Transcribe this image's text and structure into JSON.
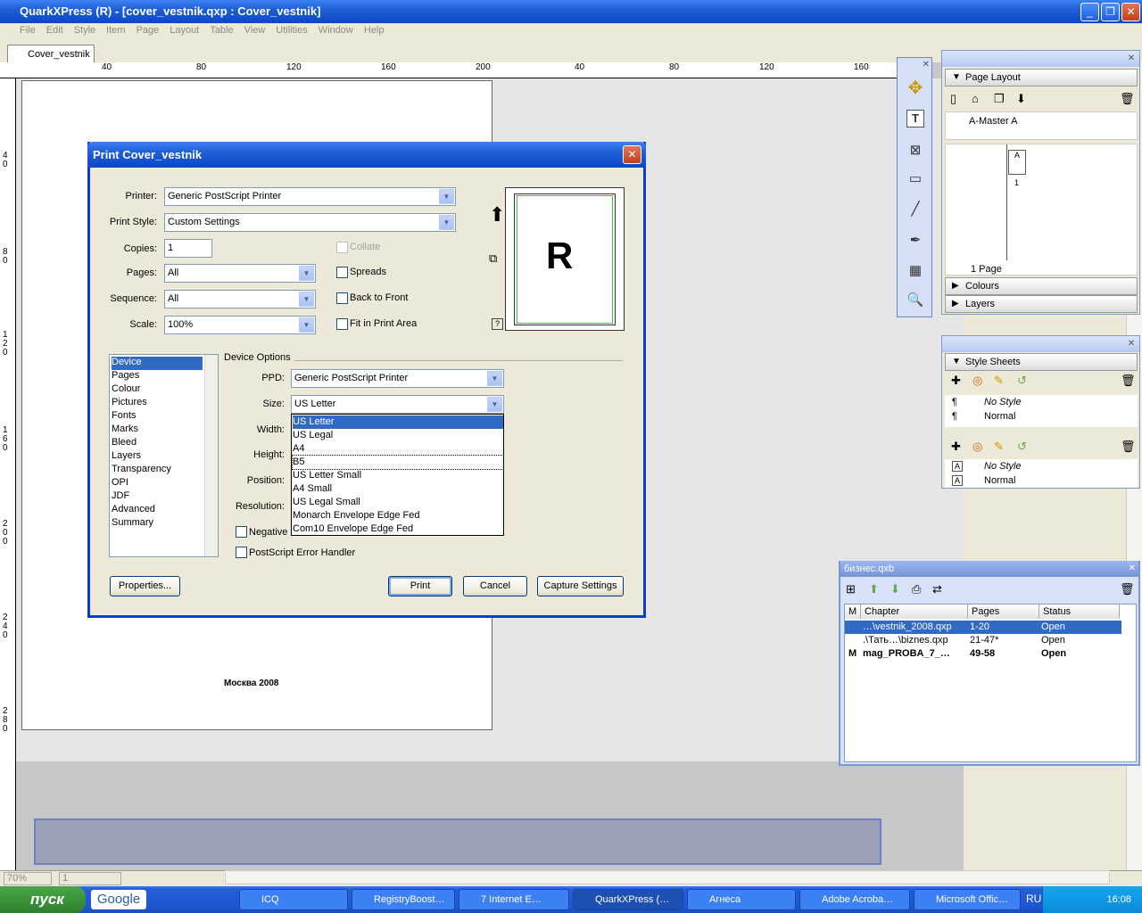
{
  "app": {
    "title": "QuarkXPress (R) - [cover_vestnik.qxp : Cover_vestnik]",
    "menu": [
      "File",
      "Edit",
      "Style",
      "Item",
      "Page",
      "Layout",
      "Table",
      "View",
      "Utilities",
      "Window",
      "Help"
    ],
    "doc_tab": "Cover_vestnik",
    "window_buttons": [
      "_",
      "❐",
      "✕"
    ]
  },
  "rulers": {
    "h_marks": [
      "40",
      "80",
      "120",
      "160",
      "200",
      "40",
      "80",
      "120",
      "160"
    ],
    "v_marks": [
      "40",
      "80",
      "120",
      "160",
      "200",
      "240",
      "280"
    ]
  },
  "page": {
    "footer_text": "Москва 2008"
  },
  "dialog": {
    "title": "Print Cover_vestnik",
    "printer_label": "Printer:",
    "printer_value": "Generic PostScript Printer",
    "style_label": "Print Style:",
    "style_value": "Custom Settings",
    "copies_label": "Copies:",
    "copies_value": "1",
    "pages_label": "Pages:",
    "pages_value": "All",
    "sequence_label": "Sequence:",
    "sequence_value": "All",
    "scale_label": "Scale:",
    "scale_value": "100%",
    "collate": "Collate",
    "spreads": "Spreads",
    "back_to_front": "Back to Front",
    "fit_print_area": "Fit in Print Area",
    "preview_letter": "R",
    "help": "?",
    "categories": [
      "Device",
      "Pages",
      "Colour",
      "Pictures",
      "Fonts",
      "Marks",
      "Bleed",
      "Layers",
      "Transparency",
      "OPI",
      "JDF",
      "Advanced",
      "Summary"
    ],
    "device_options": "Device Options",
    "ppd_label": "PPD:",
    "ppd_value": "Generic PostScript Printer",
    "size_label": "Size:",
    "size_value": "US Letter",
    "width_label": "Width:",
    "height_label": "Height:",
    "position_label": "Position:",
    "resolution_label": "Resolution:",
    "negative": "Negative",
    "ps_error": "PostScript Error Handler",
    "size_options": [
      "US Letter",
      "US Legal",
      "A4",
      "B5",
      "US Letter Small",
      "A4 Small",
      "US Legal Small",
      "Monarch Envelope Edge Fed",
      "Com10 Envelope Edge Fed"
    ],
    "properties_btn": "Properties...",
    "print_btn": "Print",
    "cancel_btn": "Cancel",
    "capture_btn": "Capture Settings"
  },
  "page_layout": {
    "title": "Page Layout",
    "master": "A-Master A",
    "page_label": "A",
    "page_num": "1",
    "page_count": "1 Page",
    "colours": "Colours",
    "layers": "Layers"
  },
  "style_sheets": {
    "title": "Style Sheets",
    "para": [
      "No Style",
      "Normal"
    ],
    "char": [
      "No Style",
      "Normal"
    ]
  },
  "book": {
    "title": "бизнес.qxb",
    "headers": [
      "M",
      "Chapter",
      "Pages",
      "Status"
    ],
    "rows": [
      {
        "m": "",
        "chapter": "…\\vestnik_2008.qxp",
        "pages": "1-20",
        "status": "Open"
      },
      {
        "m": "",
        "chapter": ".\\Тать…\\biznes.qxp",
        "pages": "21-47*",
        "status": "Open"
      },
      {
        "m": "M",
        "chapter": "mag_PROBA_7_…",
        "pages": "49-58",
        "status": "Open"
      }
    ]
  },
  "statusbar": {
    "zoom": "70%",
    "page": "1"
  },
  "taskbar": {
    "start": "пуск",
    "google": "Google",
    "tasks": [
      "ICQ",
      "RegistryBoost…",
      "7 Internet E…",
      "QuarkXPress (…",
      "Агнеса",
      "Adobe Acroba…",
      "Microsoft Offic…"
    ],
    "lang": "RU",
    "clock": "16:08"
  }
}
